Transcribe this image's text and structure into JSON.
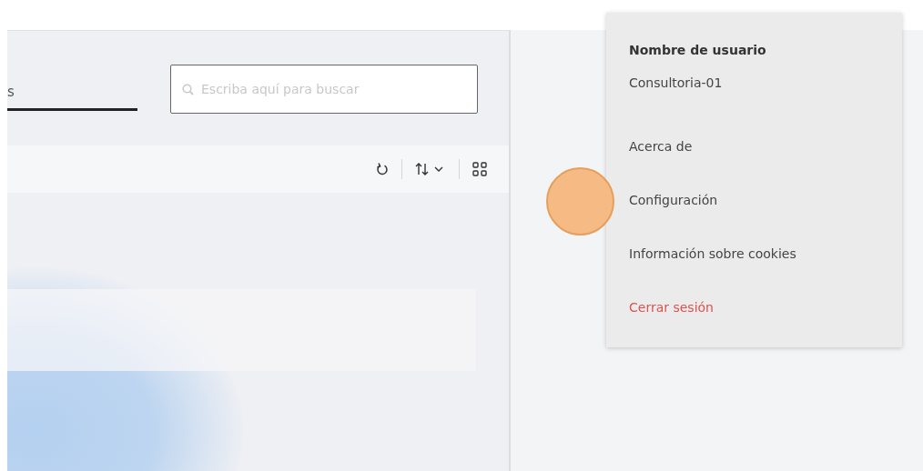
{
  "tabs": [
    {
      "label": "s",
      "selected": true
    }
  ],
  "search": {
    "placeholder": "Escriba aquí para buscar"
  },
  "user_menu": {
    "title": "Nombre de usuario",
    "username": "Consultoria-01",
    "items": [
      {
        "label": "Acerca de",
        "kind": "normal"
      },
      {
        "label": "Configuración",
        "kind": "normal"
      },
      {
        "label": "Información sobre cookies",
        "kind": "normal"
      },
      {
        "label": "Cerrar sesión",
        "kind": "danger"
      }
    ]
  }
}
